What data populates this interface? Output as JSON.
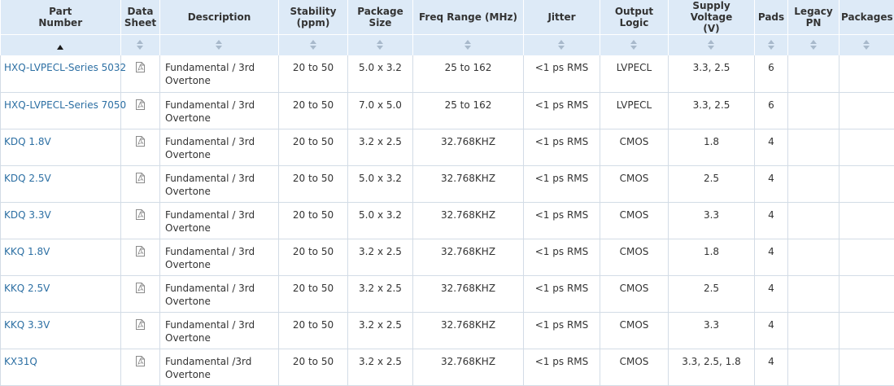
{
  "headers": [
    {
      "lines": [
        "Part",
        "Number"
      ]
    },
    {
      "lines": [
        "Data",
        "Sheet"
      ]
    },
    {
      "lines": [
        "Description"
      ]
    },
    {
      "lines": [
        "Stability",
        "(ppm)"
      ]
    },
    {
      "lines": [
        "Package",
        "Size"
      ]
    },
    {
      "lines": [
        "Freq Range (MHz)"
      ]
    },
    {
      "lines": [
        "Jitter"
      ]
    },
    {
      "lines": [
        "Output",
        "Logic"
      ]
    },
    {
      "lines": [
        "Supply Voltage",
        "(V)"
      ]
    },
    {
      "lines": [
        "Pads"
      ]
    },
    {
      "lines": [
        "Legacy",
        "PN"
      ]
    },
    {
      "lines": [
        "Packages"
      ]
    }
  ],
  "sort": {
    "active_column": "Part Number",
    "direction": "ascending"
  },
  "icons": {
    "datasheet": "pdf-file-icon",
    "sort": "sort-icon",
    "sort_active": "sort-ascending-icon"
  },
  "colors": {
    "header_bg": "#ddeaf7",
    "link": "#2c6fa3",
    "border": "#d3dce6"
  },
  "rows": [
    {
      "part": "HXQ-LVPECL-Series 5032",
      "desc": [
        "Fundamental / 3rd",
        "Overtone"
      ],
      "stability": "20 to 50",
      "package": "5.0 x 3.2",
      "freq": "25 to 162",
      "jitter": "<1 ps RMS",
      "logic": "LVPECL",
      "voltage": "3.3, 2.5",
      "pads": "6",
      "legacy": "",
      "packages": ""
    },
    {
      "part": "HXQ-LVPECL-Series 7050",
      "desc": [
        "Fundamental / 3rd",
        "Overtone"
      ],
      "stability": "20 to 50",
      "package": "7.0 x 5.0",
      "freq": "25 to 162",
      "jitter": "<1 ps RMS",
      "logic": "LVPECL",
      "voltage": "3.3, 2.5",
      "pads": "6",
      "legacy": "",
      "packages": ""
    },
    {
      "part": "KDQ 1.8V",
      "desc": [
        "Fundamental / 3rd",
        "Overtone"
      ],
      "stability": "20 to 50",
      "package": "3.2 x 2.5",
      "freq": "32.768KHZ",
      "jitter": "<1 ps RMS",
      "logic": "CMOS",
      "voltage": "1.8",
      "pads": "4",
      "legacy": "",
      "packages": ""
    },
    {
      "part": "KDQ 2.5V",
      "desc": [
        "Fundamental / 3rd",
        "Overtone"
      ],
      "stability": "20 to 50",
      "package": "5.0 x 3.2",
      "freq": "32.768KHZ",
      "jitter": "<1 ps RMS",
      "logic": "CMOS",
      "voltage": "2.5",
      "pads": "4",
      "legacy": "",
      "packages": ""
    },
    {
      "part": "KDQ 3.3V",
      "desc": [
        "Fundamental / 3rd",
        "Overtone"
      ],
      "stability": "20 to 50",
      "package": "5.0 x 3.2",
      "freq": "32.768KHZ",
      "jitter": "<1 ps RMS",
      "logic": "CMOS",
      "voltage": "3.3",
      "pads": "4",
      "legacy": "",
      "packages": ""
    },
    {
      "part": "KKQ 1.8V",
      "desc": [
        "Fundamental / 3rd",
        "Overtone"
      ],
      "stability": "20 to 50",
      "package": "3.2 x 2.5",
      "freq": "32.768KHZ",
      "jitter": "<1 ps RMS",
      "logic": "CMOS",
      "voltage": "1.8",
      "pads": "4",
      "legacy": "",
      "packages": ""
    },
    {
      "part": "KKQ 2.5V",
      "desc": [
        "Fundamental / 3rd",
        "Overtone"
      ],
      "stability": "20 to 50",
      "package": "3.2 x 2.5",
      "freq": "32.768KHZ",
      "jitter": "<1 ps RMS",
      "logic": "CMOS",
      "voltage": "2.5",
      "pads": "4",
      "legacy": "",
      "packages": ""
    },
    {
      "part": "KKQ 3.3V",
      "desc": [
        "Fundamental / 3rd",
        "Overtone"
      ],
      "stability": "20 to 50",
      "package": "3.2 x 2.5",
      "freq": "32.768KHZ",
      "jitter": "<1 ps RMS",
      "logic": "CMOS",
      "voltage": "3.3",
      "pads": "4",
      "legacy": "",
      "packages": ""
    },
    {
      "part": "KX31Q",
      "desc": [
        "Fundamental /3rd",
        "Overtone"
      ],
      "stability": "20 to 50",
      "package": "3.2 x 2.5",
      "freq": "32.768KHZ",
      "jitter": "<1 ps RMS",
      "logic": "CMOS",
      "voltage": "3.3, 2.5, 1.8",
      "pads": "4",
      "legacy": "",
      "packages": ""
    }
  ]
}
